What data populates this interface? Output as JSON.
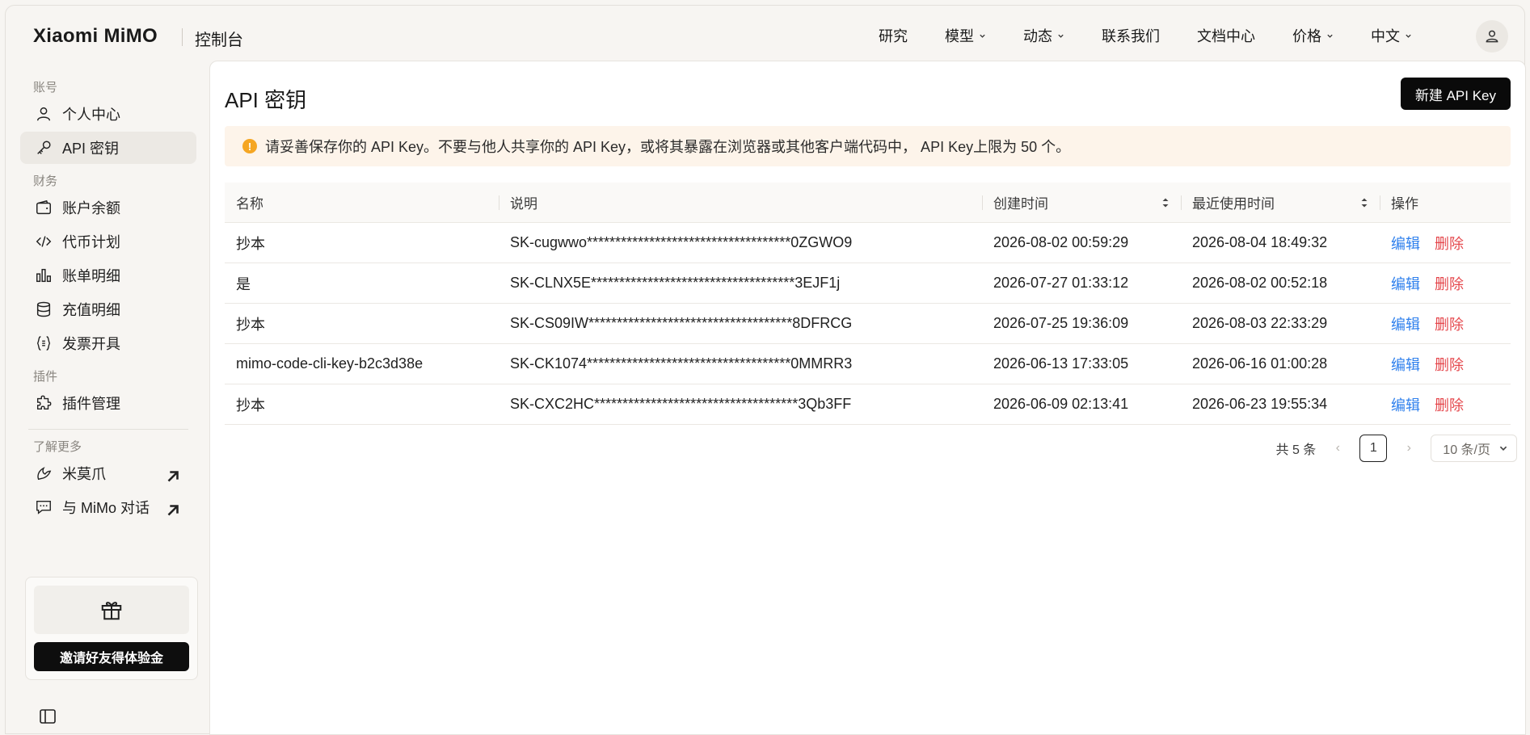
{
  "header": {
    "logo": "Xiaomi MiMO",
    "console": "控制台",
    "nav": [
      {
        "label": "研究",
        "dropdown": false
      },
      {
        "label": "模型",
        "dropdown": true
      },
      {
        "label": "动态",
        "dropdown": true
      },
      {
        "label": "联系我们",
        "dropdown": false
      },
      {
        "label": "文档中心",
        "dropdown": false
      },
      {
        "label": "价格",
        "dropdown": true
      },
      {
        "label": "中文",
        "dropdown": true
      }
    ]
  },
  "sidebar": {
    "group_account": "账号",
    "item_profile": "个人中心",
    "item_apikeys": "API 密钥",
    "group_finance": "财务",
    "item_balance": "账户余额",
    "item_token_plan": "代币计划",
    "item_bills": "账单明细",
    "item_recharge": "充值明细",
    "item_invoice": "发票开具",
    "group_plugins": "插件",
    "item_plugin_mgmt": "插件管理",
    "group_more": "了解更多",
    "item_mimoclaw": "米莫爪",
    "item_chat": "与 MiMo 对话",
    "invite_button": "邀请好友得体验金"
  },
  "main": {
    "title": "API 密钥",
    "new_button": "新建 API Key",
    "alert": "请妥善保存你的 API Key。不要与他人共享你的 API Key，或将其暴露在浏览器或其他客户端代码中， API Key上限为 50 个。",
    "columns": {
      "name": "名称",
      "desc": "说明",
      "created": "创建时间",
      "last_used": "最近使用时间",
      "ops": "操作"
    },
    "rows": [
      {
        "name": "抄本",
        "key": "SK-cugwwo************************************0ZGWO9",
        "created": "2026-08-02 00:59:29",
        "last_used": "2026-08-04 18:49:32"
      },
      {
        "name": "是",
        "key": "SK-CLNX5E************************************3EJF1j",
        "created": "2026-07-27 01:33:12",
        "last_used": "2026-08-02 00:52:18"
      },
      {
        "name": "抄本",
        "key": "SK-CS09IW************************************8DFRCG",
        "created": "2026-07-25 19:36:09",
        "last_used": "2026-08-03 22:33:29"
      },
      {
        "name": "mimo-code-cli-key-b2c3d38e",
        "key": "SK-CK1074************************************0MMRR3",
        "created": "2026-06-13 17:33:05",
        "last_used": "2026-06-16 01:00:28"
      },
      {
        "name": "抄本",
        "key": "SK-CXC2HC************************************3Qb3FF",
        "created": "2026-06-09 02:13:41",
        "last_used": "2026-06-23 19:55:34"
      }
    ],
    "op_edit": "编辑",
    "op_delete": "删除",
    "pager": {
      "total": "共 5 条",
      "current": "1",
      "page_size": "10 条/页"
    }
  },
  "colors": {
    "accent_link": "#2f80ed",
    "danger": "#e5484d",
    "warning": "#f5a623",
    "alert_bg": "#fdf4ea"
  }
}
